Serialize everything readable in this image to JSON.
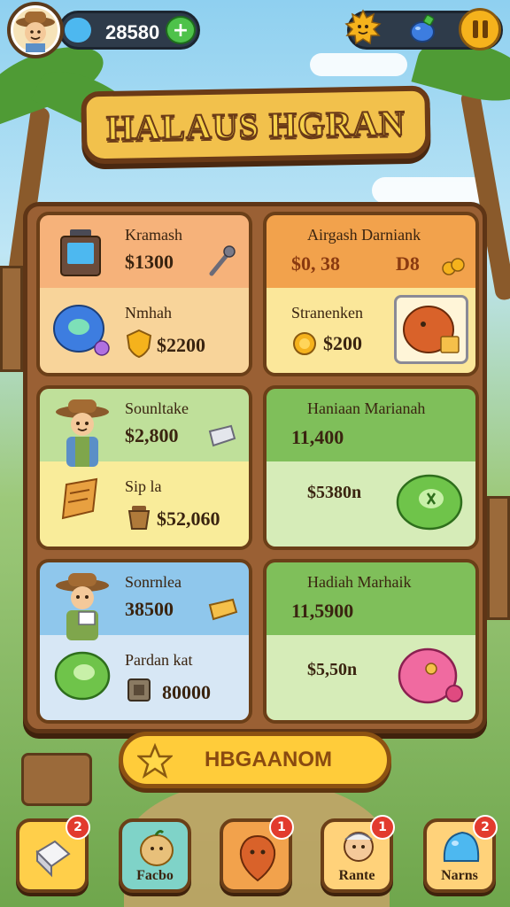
{
  "hud": {
    "currency_value": "28580",
    "plus_icon": "plus-icon",
    "pause_icon": "pause-icon"
  },
  "title": "HALAUS HGRAN",
  "cards": [
    {
      "top_label": "Kramash",
      "top_price": "$1300",
      "bottom_label": "Nmhah",
      "bottom_price": "$2200",
      "top_color": "#f6b27a",
      "bottom_color": "#f8d49a"
    },
    {
      "top_label": "Airgash Darniank",
      "top_price": "$0, 38",
      "top_extra": "D8",
      "bottom_label": "Stranenken",
      "bottom_price": "$200",
      "top_color": "#f2a24c",
      "bottom_color": "#fbe79a"
    },
    {
      "top_label": "Sounltake",
      "top_price": "$2,800",
      "bottom_label": "Sip la",
      "bottom_price": "$52,060",
      "top_color": "#bfe09a",
      "bottom_color": "#f9ec9a"
    },
    {
      "top_label": "Haniaan Marianah",
      "top_price": "11,400",
      "bottom_price": "$5380n",
      "top_color": "#7fbf5a",
      "bottom_color": "#d6ecb8"
    },
    {
      "top_label": "Sonrnlea",
      "top_price": "38500",
      "bottom_label": "Pardan kat",
      "bottom_price": "80000",
      "top_color": "#8fc7ec",
      "bottom_color": "#d7e7f5"
    },
    {
      "top_label": "Hadiah Marhaik",
      "top_price": "11,5900",
      "bottom_price": "$5,50n",
      "top_color": "#7fbf5a",
      "bottom_color": "#d6ecb8"
    }
  ],
  "action_button": {
    "label": "HBGAANOM"
  },
  "nav": [
    {
      "label": "",
      "badge": "2",
      "color": "#ffcf4a"
    },
    {
      "label": "Facbo",
      "badge": "",
      "color": "#7fd3c8"
    },
    {
      "label": "",
      "badge": "1",
      "color": "#f2a24c"
    },
    {
      "label": "Rante",
      "badge": "1",
      "color": "#ffd27a"
    },
    {
      "label": "Narns",
      "badge": "2",
      "color": "#ffd27a"
    }
  ]
}
